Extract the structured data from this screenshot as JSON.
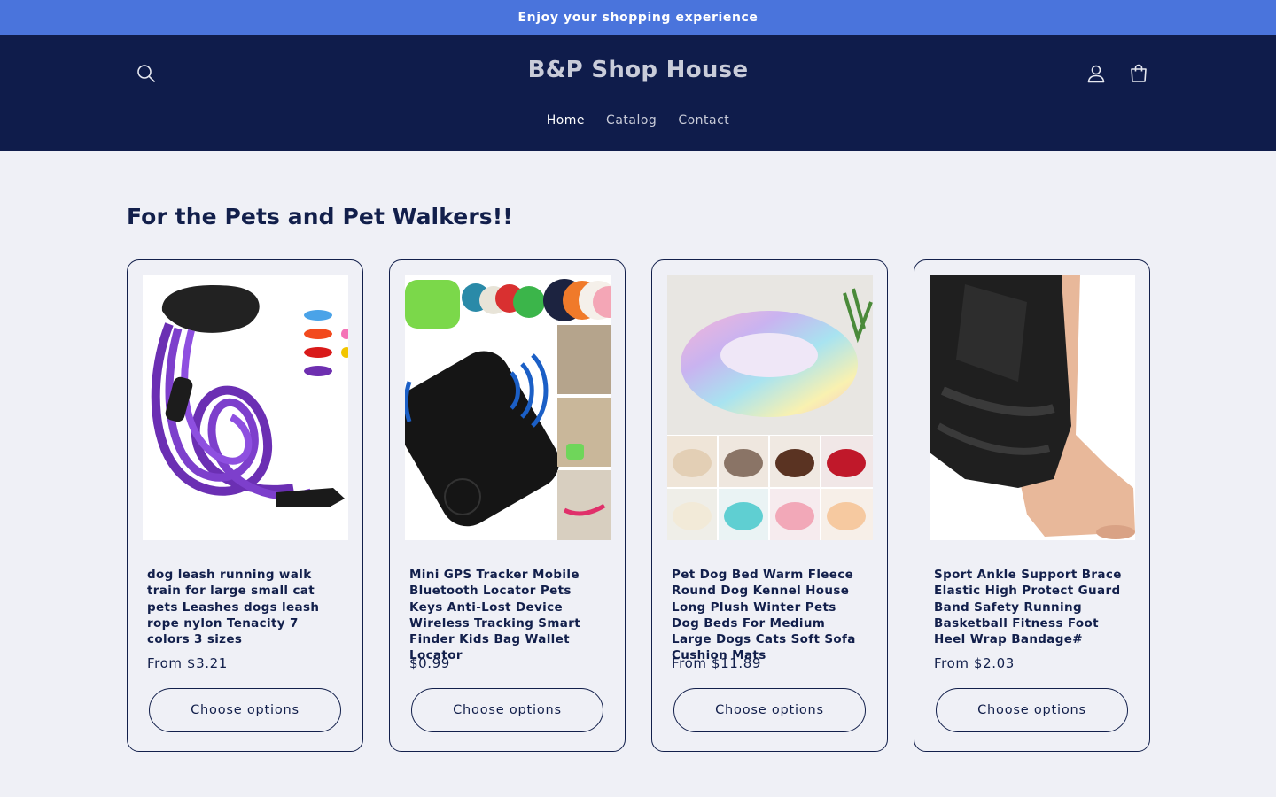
{
  "announcement": {
    "text": "Enjoy your shopping experience"
  },
  "header": {
    "title": "B&P Shop House",
    "icons": {
      "search": "search-icon",
      "account": "account-icon",
      "cart": "cart-icon"
    },
    "nav": [
      {
        "label": "Home",
        "active": true
      },
      {
        "label": "Catalog",
        "active": false
      },
      {
        "label": "Contact",
        "active": false
      }
    ]
  },
  "colors": {
    "announcement_bg": "#4a74dc",
    "header_bg": "#0f1c4b",
    "page_bg": "#eff0f6",
    "text": "#121f4b"
  },
  "section": {
    "title": "For the Pets and Pet Walkers!!",
    "products": [
      {
        "name": "dog leash running walk train for large small cat pets Leashes dogs leash rope nylon Tenacity 7 colors 3 sizes",
        "price": "From $3.21",
        "button": "Choose options"
      },
      {
        "name": "Mini GPS Tracker Mobile Bluetooth Locator Pets Keys Anti-Lost Device Wireless Tracking Smart Finder Kids Bag Wallet Locator",
        "price": "$0.99",
        "button": "Choose options"
      },
      {
        "name": "Pet Dog Bed Warm Fleece Round Dog Kennel House Long Plush Winter Pets Dog Beds For Medium Large Dogs Cats Soft Sofa Cushion Mats",
        "price": "From $11.89",
        "button": "Choose options"
      },
      {
        "name": "Sport Ankle Support Brace Elastic High Protect Guard Band Safety Running Basketball Fitness Foot Heel Wrap Bandage#",
        "price": "From $2.03",
        "button": "Choose options"
      }
    ]
  }
}
